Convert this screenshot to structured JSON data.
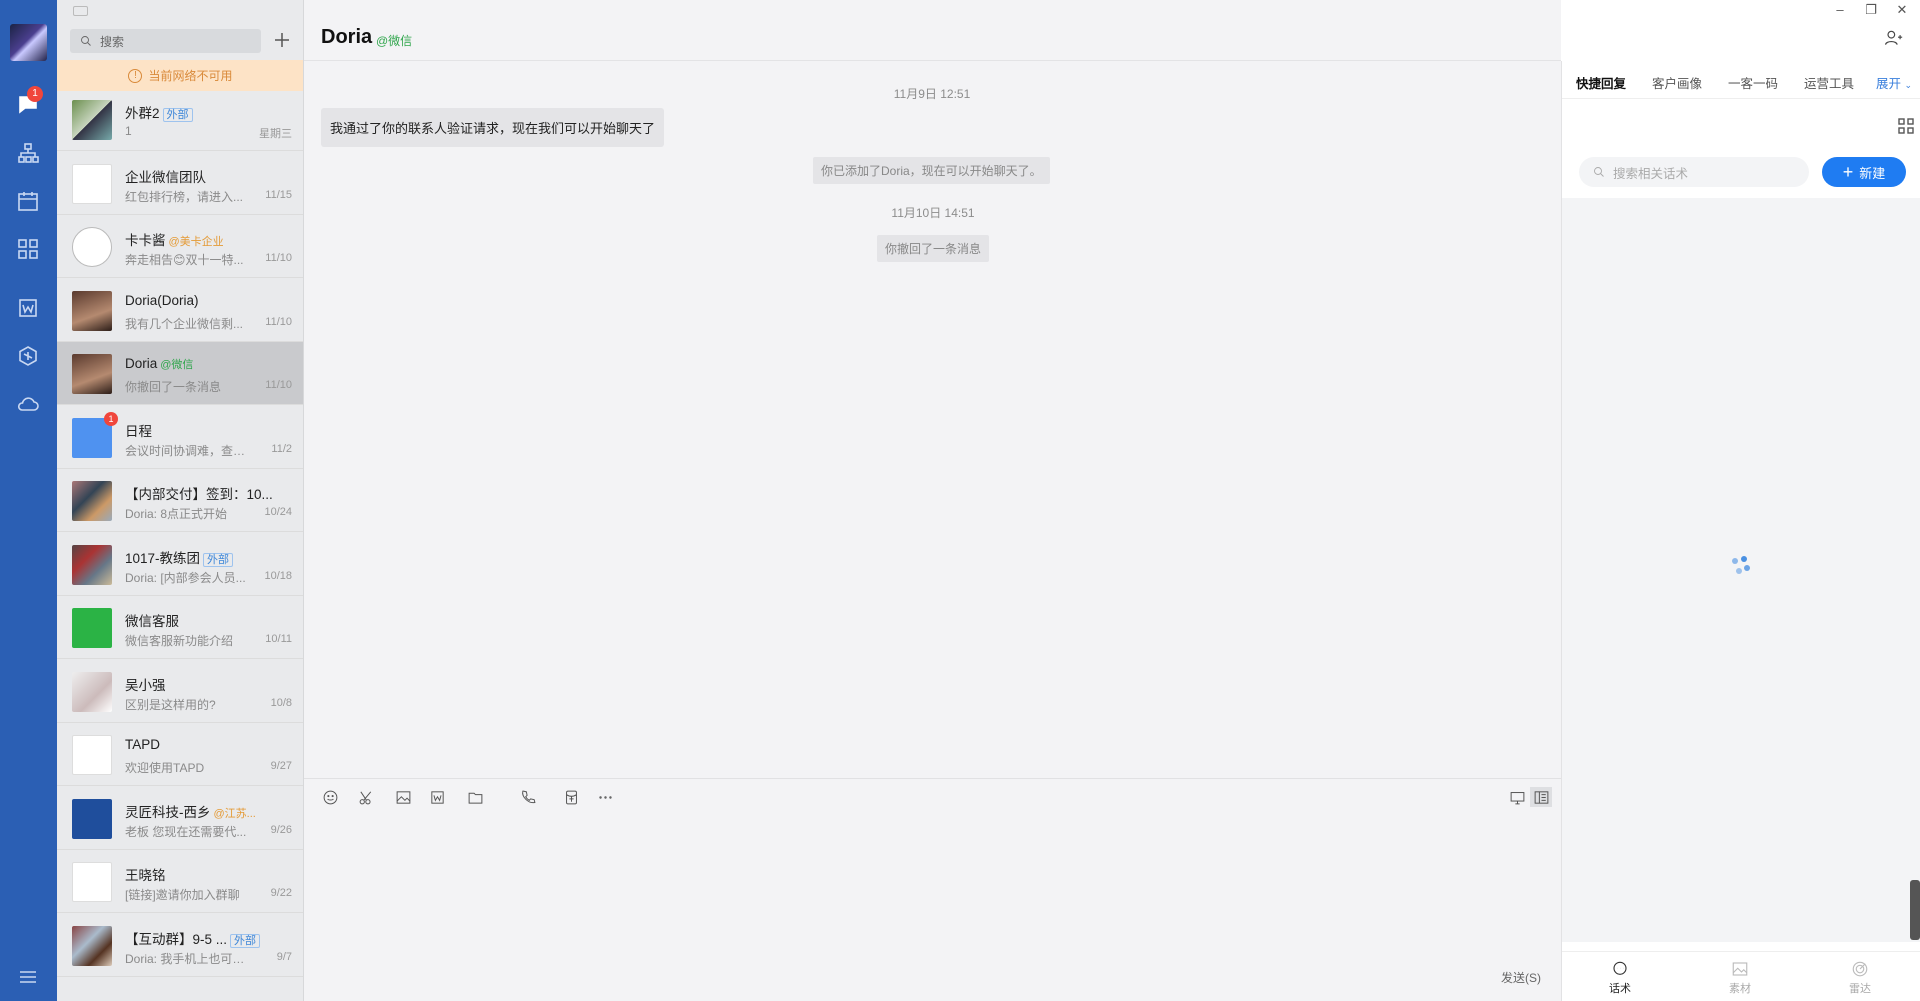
{
  "rail": {
    "chat_badge": "1"
  },
  "convlist": {
    "search_placeholder": "搜索",
    "network_warning": "当前网络不可用",
    "items": [
      {
        "name": "外群2",
        "tag": "外部",
        "tag_type": "ext",
        "preview": "1",
        "time": "星期三"
      },
      {
        "name": "企业微信团队",
        "tag": "",
        "tag_type": "",
        "preview": "红包排行榜，请进入...",
        "time": "11/15"
      },
      {
        "name": "卡卡酱",
        "tag": "@美卡企业",
        "tag_type": "org",
        "preview": "奔走相告😊双十一特...",
        "time": "11/10"
      },
      {
        "name": "Doria(Doria)",
        "tag": "",
        "tag_type": "",
        "preview": "我有几个企业微信剩...",
        "time": "11/10"
      },
      {
        "name": "Doria",
        "tag": "@微信",
        "tag_type": "wx",
        "preview": "你撤回了一条消息",
        "time": "11/10",
        "selected": true
      },
      {
        "name": "日程",
        "tag": "",
        "tag_type": "",
        "preview": "会议时间协调难，查看...",
        "time": "11/2",
        "badge": "1"
      },
      {
        "name": "【内部交付】签到：10...",
        "tag": "",
        "tag_type": "",
        "preview": "Doria: 8点正式开始",
        "time": "10/24"
      },
      {
        "name": "1017-教练团",
        "tag": "外部",
        "tag_type": "ext",
        "preview": "Doria: [内部参会人员...",
        "time": "10/18"
      },
      {
        "name": "微信客服",
        "tag": "",
        "tag_type": "",
        "preview": "微信客服新功能介绍",
        "time": "10/11"
      },
      {
        "name": "吴小强",
        "tag": "",
        "tag_type": "",
        "preview": "区别是这样用的?",
        "time": "10/8"
      },
      {
        "name": "TAPD",
        "tag": "",
        "tag_type": "",
        "preview": "欢迎使用TAPD",
        "time": "9/27"
      },
      {
        "name": "灵匠科技-西乡",
        "tag": "@江苏...",
        "tag_type": "org",
        "preview": "老板   您现在还需要代...",
        "time": "9/26"
      },
      {
        "name": "王晓铭",
        "tag": "",
        "tag_type": "",
        "preview": "[链接]邀请你加入群聊",
        "time": "9/22"
      },
      {
        "name": "【互动群】9-5 ...",
        "tag": "外部",
        "tag_type": "ext",
        "preview": "Doria: 我手机上也可以...",
        "time": "9/7"
      }
    ]
  },
  "chat": {
    "title": "Doria",
    "title_tag": "@微信",
    "time1": "11月9日 12:51",
    "message1": "我通过了你的联系人验证请求，现在我们可以开始聊天了",
    "system1": "你已添加了Doria，现在可以开始聊天了。",
    "time2": "11月10日 14:51",
    "system2": "你撤回了一条消息",
    "send_label": "发送(S)"
  },
  "panel": {
    "tabs": [
      "快捷回复",
      "客户画像",
      "一客一码",
      "运营工具"
    ],
    "expand": "展开",
    "search_placeholder": "搜索相关话术",
    "new_button": "新建",
    "footer": [
      "话术",
      "素材",
      "雷达"
    ]
  },
  "colors": {
    "rail_bg": "#2b5fb4",
    "accent": "#1f7cf2",
    "wechat_green": "#31a64d",
    "badge_red": "#f0463c"
  }
}
